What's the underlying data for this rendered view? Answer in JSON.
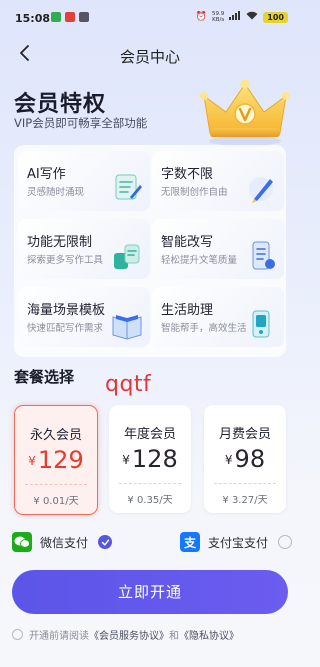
{
  "status": {
    "time": "15:08",
    "net_speed_value": "59.9",
    "net_speed_unit": "KB/s",
    "battery": "100",
    "app_dots": [
      "#2fae4f",
      "#e2403a",
      "#555566"
    ]
  },
  "nav": {
    "title": "会员中心"
  },
  "hero": {
    "title": "会员特权",
    "subtitle": "VIP会员即可畅享全部功能"
  },
  "features": [
    {
      "title": "AI写作",
      "desc": "灵感随时涌现",
      "icon": "ai-writing-icon"
    },
    {
      "title": "字数不限",
      "desc": "无限制创作自由",
      "icon": "pen-icon"
    },
    {
      "title": "功能无限制",
      "desc": "探索更多写作工具",
      "icon": "tools-icon"
    },
    {
      "title": "智能改写",
      "desc": "轻松提升文笔质量",
      "icon": "rewrite-icon"
    },
    {
      "title": "海量场景模板",
      "desc": "快速匹配写作需求",
      "icon": "book-icon"
    },
    {
      "title": "生活助理",
      "desc": "智能帮手，高效生活",
      "icon": "assistant-icon"
    }
  ],
  "plans": {
    "section_label": "套餐选择",
    "watermark": "qqtf",
    "currency": "¥",
    "items": [
      {
        "name": "永久会员",
        "price": "129",
        "per": "¥ 0.01/天",
        "selected": true
      },
      {
        "name": "年度会员",
        "price": "128",
        "per": "¥ 0.35/天",
        "selected": false
      },
      {
        "name": "月费会员",
        "price": "98",
        "per": "¥ 3.27/天",
        "selected": false
      }
    ]
  },
  "payment": {
    "wechat_label": "微信支付",
    "alipay_label": "支付宝支付",
    "selected": "wechat",
    "wechat_color": "#1aad19",
    "alipay_color": "#1677ff"
  },
  "cta": {
    "label": "立即开通"
  },
  "agreement": {
    "prefix": "开通前请阅读",
    "service_link": "《会员服务协议》",
    "joiner": "和",
    "privacy_link": "《隐私协议》"
  },
  "colors": {
    "accent": "#5b55e8",
    "price_red": "#e53b30",
    "selected_border": "#f06b5b"
  }
}
